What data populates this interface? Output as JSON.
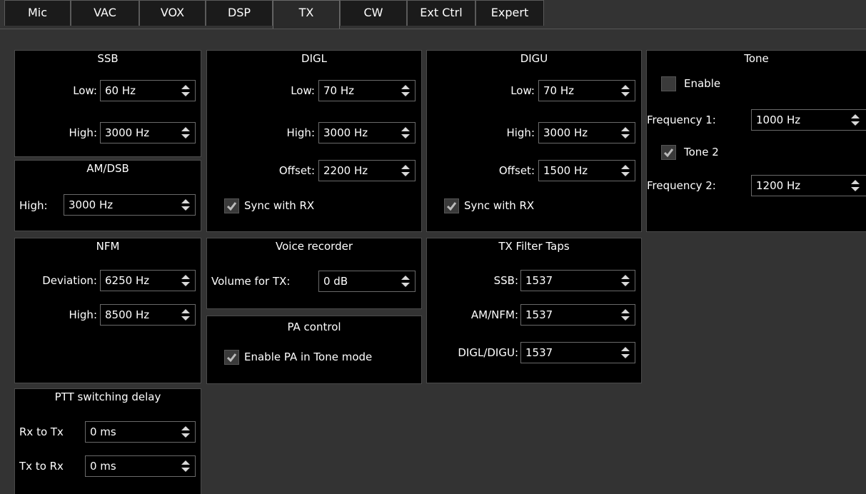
{
  "tabs": [
    {
      "label": "Mic"
    },
    {
      "label": "VAC"
    },
    {
      "label": "VOX"
    },
    {
      "label": "DSP"
    },
    {
      "label": "TX"
    },
    {
      "label": "CW"
    },
    {
      "label": "Ext Ctrl"
    },
    {
      "label": "Expert"
    }
  ],
  "active_tab": "TX",
  "ssb": {
    "title": "SSB",
    "low_label": "Low:",
    "low_value": "60 Hz",
    "high_label": "High:",
    "high_value": "3000 Hz"
  },
  "amdsb": {
    "title": "AM/DSB",
    "high_label": "High:",
    "high_value": "3000 Hz"
  },
  "nfm": {
    "title": "NFM",
    "deviation_label": "Deviation:",
    "deviation_value": "6250 Hz",
    "high_label": "High:",
    "high_value": "8500 Hz"
  },
  "ptt": {
    "title": "PTT switching delay",
    "rx_to_tx_label": "Rx to Tx",
    "rx_to_tx_value": "0 ms",
    "tx_to_rx_label": "Tx to Rx",
    "tx_to_rx_value": "0 ms"
  },
  "digl": {
    "title": "DIGL",
    "low_label": "Low:",
    "low_value": "70 Hz",
    "high_label": "High:",
    "high_value": "3000 Hz",
    "offset_label": "Offset:",
    "offset_value": "2200 Hz",
    "sync_label": "Sync with RX",
    "sync_checked": true
  },
  "digu": {
    "title": "DIGU",
    "low_label": "Low:",
    "low_value": "70 Hz",
    "high_label": "High:",
    "high_value": "3000 Hz",
    "offset_label": "Offset:",
    "offset_value": "1500 Hz",
    "sync_label": "Sync with RX",
    "sync_checked": true
  },
  "voice": {
    "title": "Voice recorder",
    "volume_label": "Volume for TX:",
    "volume_value": "0 dB"
  },
  "pa": {
    "title": "PA control",
    "enable_label": "Enable PA in Tone mode",
    "enable_checked": true
  },
  "taps": {
    "title": "TX Filter Taps",
    "ssb_label": "SSB:",
    "ssb_value": "1537",
    "amnfm_label": "AM/NFM:",
    "amnfm_value": "1537",
    "digl_digu_label": "DIGL/DIGU:",
    "digl_digu_value": "1537"
  },
  "tone": {
    "title": "Tone",
    "enable_label": "Enable",
    "enable_checked": false,
    "freq1_label": "Frequency 1:",
    "freq1_value": "1000 Hz",
    "tone2_label": "Tone 2",
    "tone2_checked": true,
    "freq2_label": "Frequency 2:",
    "freq2_value": "1200 Hz"
  },
  "colors": {
    "background": "#333333",
    "group_bg": "#000000",
    "text": "#ffffff",
    "check": "#bbbbbb"
  }
}
